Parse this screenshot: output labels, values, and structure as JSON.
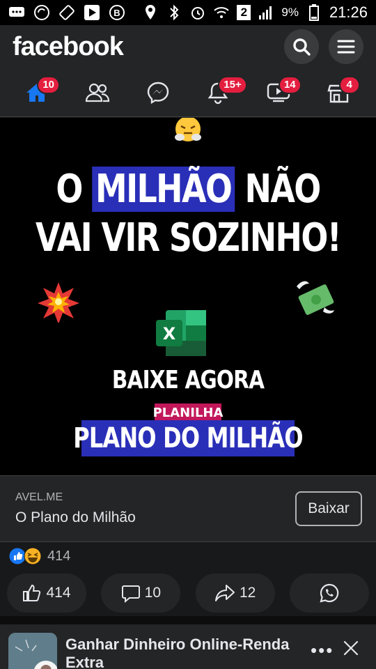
{
  "status_bar": {
    "battery_percent": "9%",
    "time": "21:26",
    "sim_label": "2"
  },
  "header": {
    "logo_text": "facebook"
  },
  "nav": {
    "tabs": [
      {
        "name": "home",
        "badge": "10"
      },
      {
        "name": "friends",
        "badge": ""
      },
      {
        "name": "messenger",
        "badge": ""
      },
      {
        "name": "notifications",
        "badge": "15+"
      },
      {
        "name": "watch",
        "badge": "14"
      },
      {
        "name": "marketplace",
        "badge": "4"
      }
    ]
  },
  "ad": {
    "headline_line1_pre": "O ",
    "headline_line1_mark": "MILHÃO",
    "headline_line1_post": " NÃO",
    "headline_line2": "VAI VIR SOZINHO!",
    "excel_letter": "X",
    "cta_text": "BAIXE AGORA",
    "tag_text": "PLANILHA",
    "product_text": "PLANO DO MILHÃO"
  },
  "link": {
    "domain": "AVEL.ME",
    "title": "O Plano do Milhão",
    "button_label": "Baixar"
  },
  "reactions": {
    "count": "414"
  },
  "actions": {
    "like_count": "414",
    "comment_count": "10",
    "share_count": "12"
  },
  "next_post": {
    "title": "Ganhar Dinheiro Online-Renda Extra",
    "more_label": "•••"
  },
  "colors": {
    "fb_blue": "#1877f2",
    "badge_red": "#e41e3f",
    "highlight_blue": "#2a2fb8",
    "tag_pink": "#c2185b"
  }
}
